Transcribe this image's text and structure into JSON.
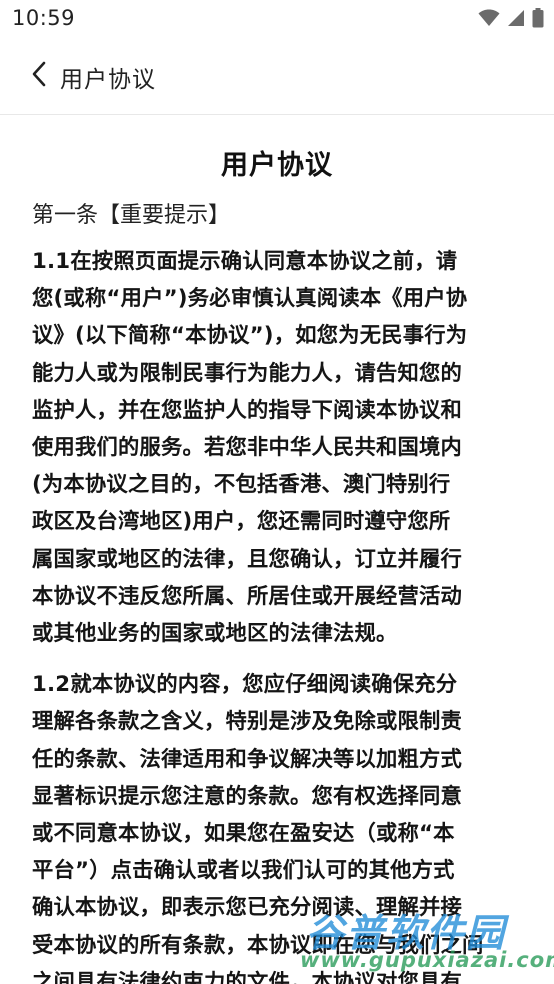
{
  "status_bar": {
    "time": "10:59",
    "icons": [
      "wifi-icon",
      "signal-icon",
      "battery-icon"
    ]
  },
  "app_bar": {
    "back_icon": "chevron-left-icon",
    "title": "用户协议"
  },
  "document": {
    "title": "用户协议",
    "section_heading": "第一条【重要提示】",
    "paragraphs": [
      {
        "lines": [
          "1.1在按照页面提示确认同意本协议之前，请",
          "您(或称“用户”)务必审慎认真阅读本《用户协",
          "议》(以下简称“本协议”)，如您为无民事行为",
          "能力人或为限制民事行为能力人，请告知您的",
          "监护人，并在您监护人的指导下阅读本协议和",
          "使用我们的服务。若您非中华人民共和国境内",
          "(为本协议之目的，不包括香港、澳门特别行",
          "政区及台湾地区)用户，您还需同时遵守您所",
          "属国家或地区的法律，且您确认，订立并履行",
          "本协议不违反您所属、所居住或开展经营活动",
          "或其他业务的国家或地区的法律法规。"
        ]
      },
      {
        "lines": [
          "1.2就本协议的内容，您应仔细阅读确保充分",
          "理解各条款之含义，特别是涉及免除或限制责",
          "任的条款、法律适用和争议解决等以加粗方式",
          "显著标识提示您注意的条款。您有权选择同意",
          "或不同意本协议，如果您在盈安达（或称“本",
          "平台”）点击确认或者以我们认可的其他方式",
          "确认本协议，即表示您已充分阅读、理解并接",
          "受本协议的所有条款，本协议即在您与我们之间",
          "之间具有法律约束力的文件，本协议对您具有"
        ]
      }
    ]
  },
  "watermark": {
    "text": "谷普软件园",
    "url": "www.gupuxiazai.com"
  },
  "colors": {
    "background": "#ffffff",
    "text": "#111111",
    "divider": "#e8e8e8"
  }
}
